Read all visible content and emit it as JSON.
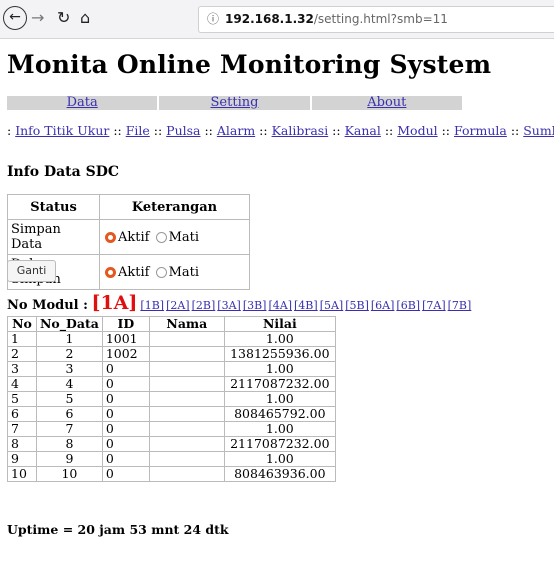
{
  "browser": {
    "url_host": "192.168.1.32",
    "url_path": "/setting.html?smb=11"
  },
  "page_title": "Monita Online Monitoring System",
  "menu": [
    "Data",
    "Setting",
    "About"
  ],
  "links": [
    "Info Titik Ukur",
    "File",
    "Pulsa",
    "Alarm",
    "Kalibrasi",
    "Kanal",
    "Modul",
    "Formula",
    "Sumber"
  ],
  "section_title": "Info Data SDC",
  "status_table": {
    "headers": [
      "Status",
      "Keterangan"
    ],
    "rows": [
      {
        "label": "Simpan Data",
        "options": [
          "Aktif",
          "Mati"
        ],
        "selected": "Aktif"
      },
      {
        "label": "Debug Simpan",
        "options": [
          "Aktif",
          "Mati"
        ],
        "selected": "Aktif"
      }
    ]
  },
  "ganti_label": "Ganti",
  "modul": {
    "label": "No Modul :",
    "current": "[1A]",
    "others": [
      "[1B]",
      "[2A]",
      "[2B]",
      "[3A]",
      "[3B]",
      "[4A]",
      "[4B]",
      "[5A]",
      "[5B]",
      "[6A]",
      "[6B]",
      "[7A]",
      "[7B]"
    ]
  },
  "data_table": {
    "headers": [
      "No",
      "No_Data",
      "ID",
      "Nama",
      "Nilai"
    ],
    "rows": [
      [
        "1",
        "1",
        "1001",
        "",
        "1.00"
      ],
      [
        "2",
        "2",
        "1002",
        "",
        "1381255936.00"
      ],
      [
        "3",
        "3",
        "0",
        "",
        "1.00"
      ],
      [
        "4",
        "4",
        "0",
        "",
        "2117087232.00"
      ],
      [
        "5",
        "5",
        "0",
        "",
        "1.00"
      ],
      [
        "6",
        "6",
        "0",
        "",
        "808465792.00"
      ],
      [
        "7",
        "7",
        "0",
        "",
        "1.00"
      ],
      [
        "8",
        "8",
        "0",
        "",
        "2117087232.00"
      ],
      [
        "9",
        "9",
        "0",
        "",
        "1.00"
      ],
      [
        "10",
        "10",
        "0",
        "",
        "808463936.00"
      ]
    ]
  },
  "uptime": "Uptime = 20 jam 53 mnt 24 dtk",
  "colors": {
    "link": "#3a2fb0",
    "current_modul": "#e01010",
    "radio_selected": "#e4571f",
    "menu_bg": "#d3d3d3"
  }
}
